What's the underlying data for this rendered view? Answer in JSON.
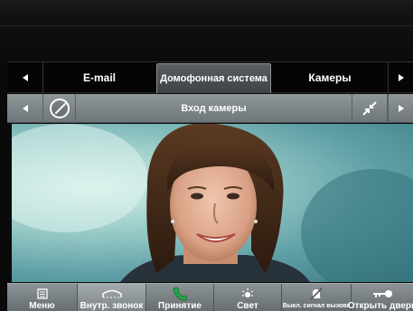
{
  "tabs": {
    "items": [
      {
        "label": "E-mail"
      },
      {
        "label": "Домофонная система"
      },
      {
        "label": "Камеры"
      }
    ],
    "active_index": 1,
    "prev_icon": "triangle-left-icon",
    "next_icon": "triangle-right-icon"
  },
  "camera_header": {
    "title": "Вход камеры",
    "prev_icon": "triangle-left-icon",
    "dial_icon": "dial-icon",
    "shrink_icon": "shrink-icon",
    "next_icon": "triangle-right-icon"
  },
  "video": {
    "content": "camera-feed"
  },
  "buttons": [
    {
      "label": "Меню",
      "icon": "menu-icon"
    },
    {
      "label": "Внутр. звонок",
      "icon": "internal-call-icon"
    },
    {
      "label": "Принятие",
      "icon": "handset-icon"
    },
    {
      "label": "Свет",
      "icon": "light-icon"
    },
    {
      "label": "Выкл. сигнал вызова",
      "icon": "mute-bell-icon"
    },
    {
      "label": "Открыть дверь",
      "icon": "key-icon"
    }
  ],
  "colors": {
    "accept_green": "#1fa64a",
    "active_tab": "#4b5053",
    "bar": "#7a8285"
  }
}
